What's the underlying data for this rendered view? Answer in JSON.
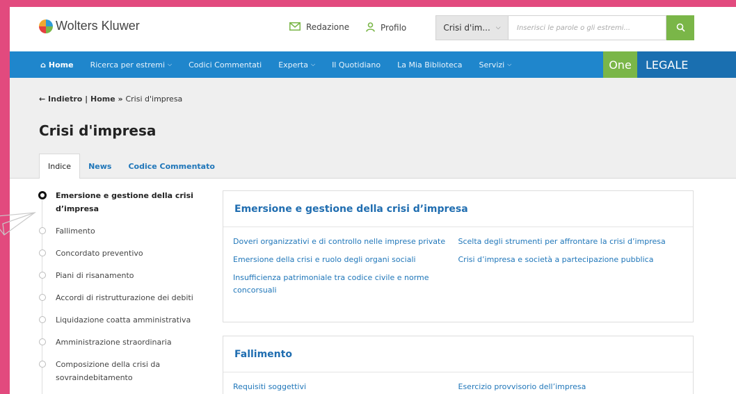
{
  "header": {
    "logo_text": "Wolters Kluwer",
    "redazione_label": "Redazione",
    "profilo_label": "Profilo",
    "search_select_value": "Crisi d'im...",
    "search_placeholder": "Inserisci le parole o gli estremi..."
  },
  "nav": {
    "items": [
      {
        "label": "Home"
      },
      {
        "label": "Ricerca per estremi"
      },
      {
        "label": "Codici Commentati"
      },
      {
        "label": "Experta"
      },
      {
        "label": "Il Quotidiano"
      },
      {
        "label": "La Mia Biblioteca"
      },
      {
        "label": "Servizi"
      }
    ],
    "brand_one": "One",
    "brand_legale": "LEGALE"
  },
  "breadcrumb": {
    "back": "← Indietro",
    "sep": " | ",
    "home": "Home",
    "arrow": " » ",
    "current": "Crisi d'impresa"
  },
  "page_title": "Crisi d'impresa",
  "tabs": [
    {
      "label": "Indice"
    },
    {
      "label": "News"
    },
    {
      "label": "Codice Commentato"
    }
  ],
  "index": [
    {
      "label": "Emersione e gestione della crisi d’impresa"
    },
    {
      "label": "Fallimento"
    },
    {
      "label": "Concordato preventivo"
    },
    {
      "label": "Piani di risanamento"
    },
    {
      "label": "Accordi di ristrutturazione dei debiti"
    },
    {
      "label": "Liquidazione coatta amministrativa"
    },
    {
      "label": "Amministrazione straordinaria"
    },
    {
      "label": "Composizione della crisi da sovraindebitamento"
    }
  ],
  "cards": [
    {
      "title": "Emersione e gestione della crisi d’impresa",
      "left": [
        "Doveri organizzativi e di controllo nelle imprese private",
        "Emersione della crisi e ruolo degli organi sociali",
        "Insufficienza patrimoniale tra codice civile e norme concorsuali"
      ],
      "right": [
        "Scelta degli strumenti per affrontare la crisi d’impresa",
        "Crisi d’impresa e società a partecipazione pubblica"
      ]
    },
    {
      "title": "Fallimento",
      "left": [
        "Requisiti soggettivi"
      ],
      "right": [
        "Esercizio provvisorio dell’impresa"
      ]
    }
  ],
  "colors": {
    "frame_pink": "#e24a7e",
    "nav_blue": "#1f86cc",
    "brand_green": "#7ab648",
    "link_blue": "#1f76b9"
  },
  "icons": {
    "logo": "globe-logo-icon",
    "redazione": "envelope-icon",
    "profilo": "user-icon",
    "search": "search-icon",
    "home": "home-icon",
    "decoration": "paper-plane-icon"
  }
}
